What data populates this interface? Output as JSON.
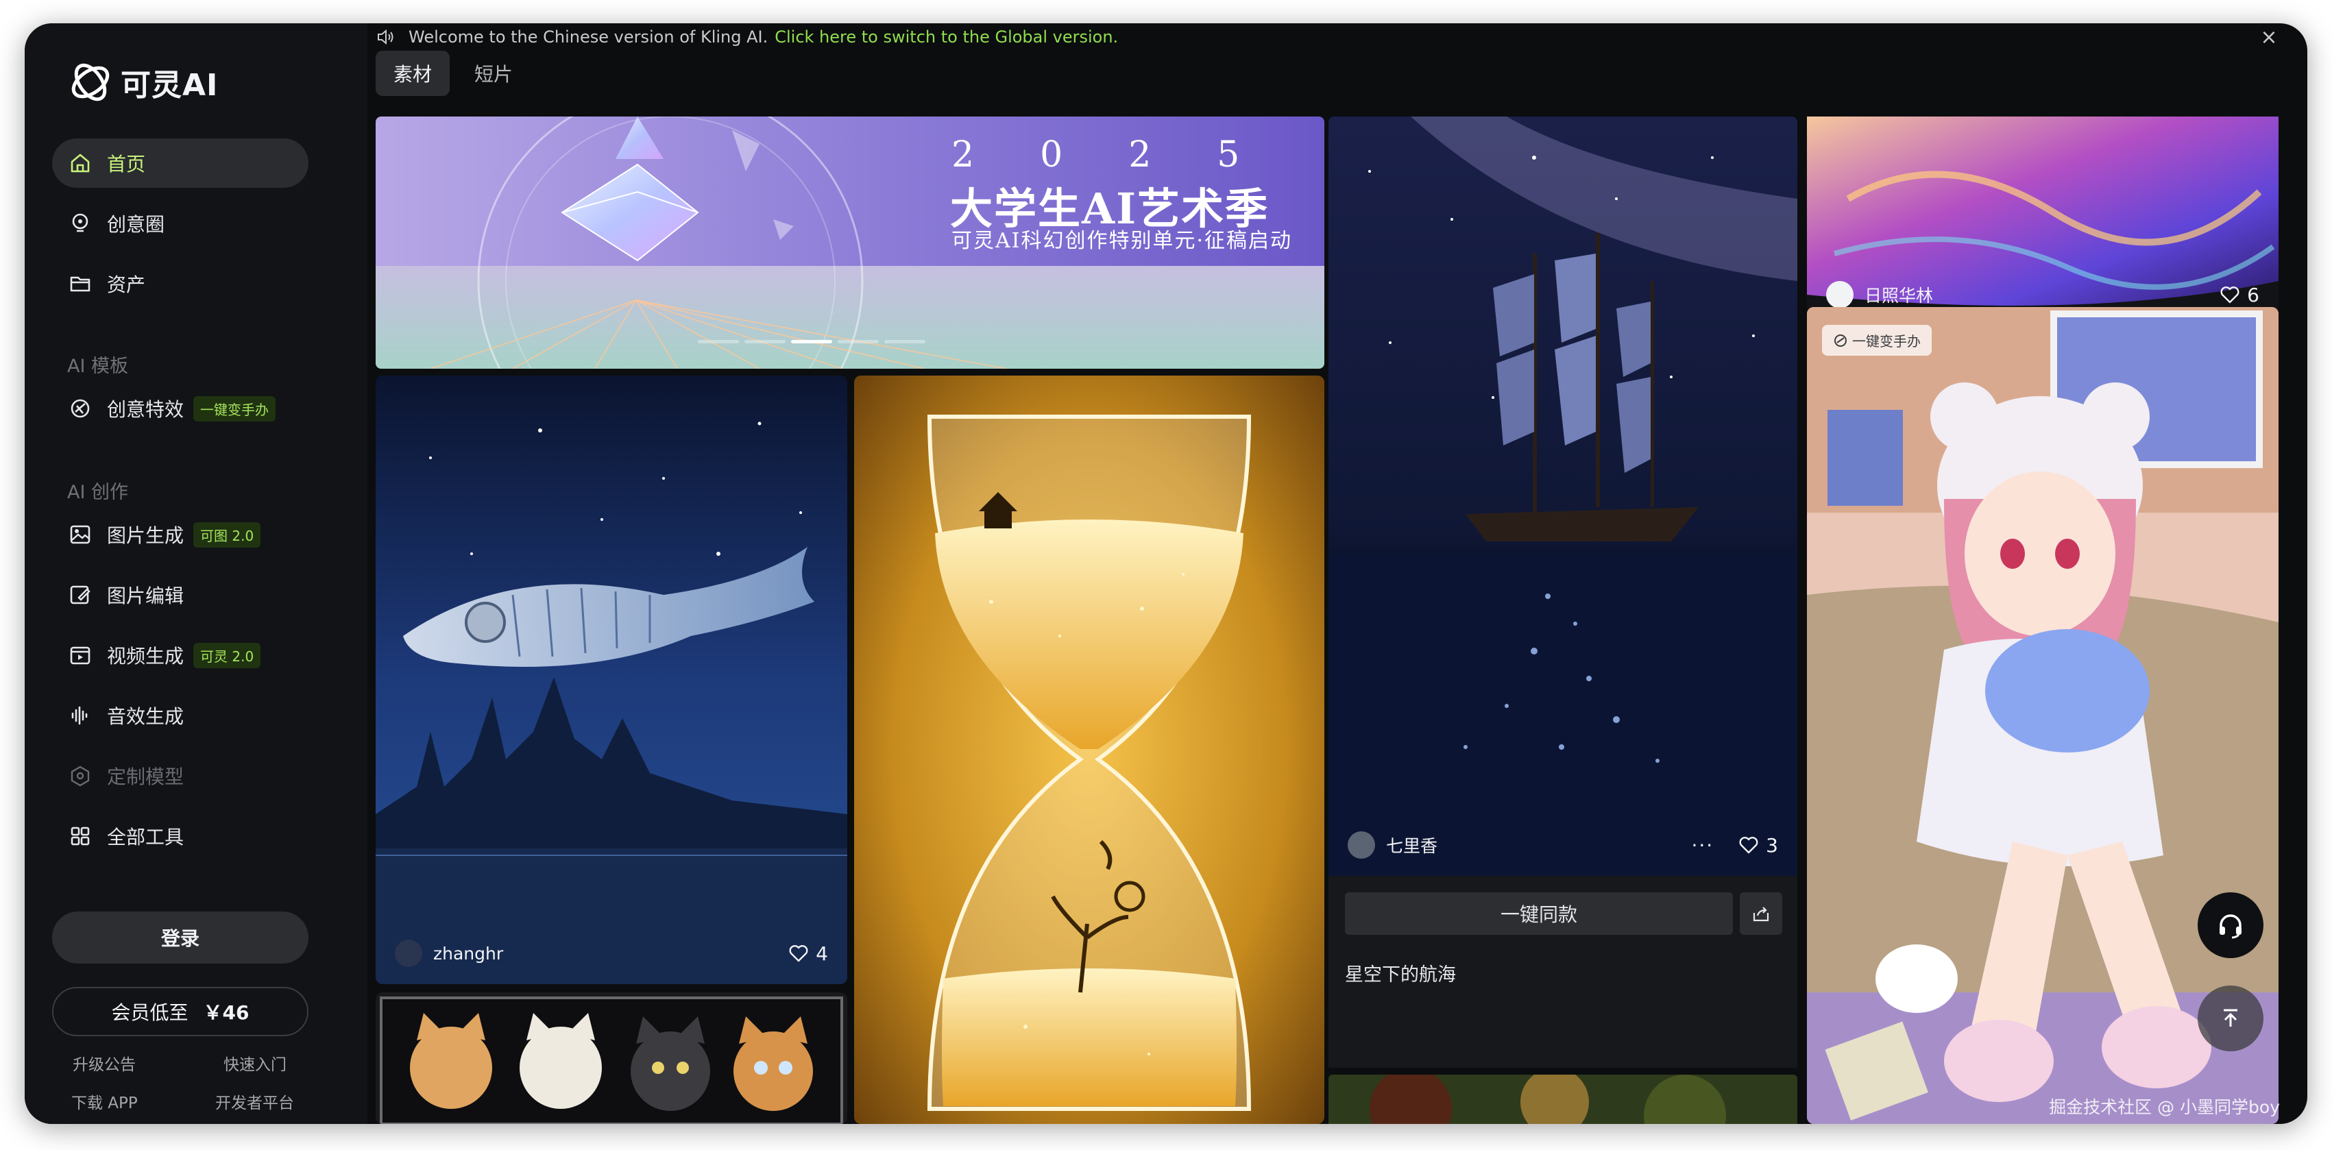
{
  "app": {
    "logo_text": "可灵AI"
  },
  "sidebar": {
    "items": [
      {
        "label": "首页",
        "icon": "home-icon",
        "active": true
      },
      {
        "label": "创意圈",
        "icon": "bulb-icon"
      },
      {
        "label": "资产",
        "icon": "folder-icon"
      }
    ],
    "section_templates": "AI 模板",
    "template_items": [
      {
        "label": "创意特效",
        "icon": "effects-icon",
        "badge": "一键变手办"
      }
    ],
    "section_create": "AI 创作",
    "create_items": [
      {
        "label": "图片生成",
        "icon": "image-icon",
        "badge": "可图 2.0"
      },
      {
        "label": "图片编辑",
        "icon": "image-edit-icon"
      },
      {
        "label": "视频生成",
        "icon": "video-icon",
        "badge": "可灵 2.0"
      },
      {
        "label": "音效生成",
        "icon": "audio-wave-icon"
      },
      {
        "label": "定制模型",
        "icon": "model-cube-icon",
        "disabled": true
      },
      {
        "label": "全部工具",
        "icon": "grid-icon"
      }
    ],
    "login_label": "登录",
    "member_label": "会员低至",
    "member_price": "￥46",
    "footer_links": [
      "升级公告",
      "快速入门",
      "下载 APP",
      "开发者平台"
    ]
  },
  "topbar": {
    "notice_text": "Welcome to the Chinese version of Kling AI.",
    "notice_link": "Click here to switch to the Global version.",
    "close_glyph": "×",
    "tabs": [
      {
        "label": "素材",
        "active": true
      },
      {
        "label": "短片",
        "active": false
      }
    ]
  },
  "banner": {
    "year_digits": [
      "2",
      "0",
      "2",
      "5"
    ],
    "title": "大学生AI艺术季",
    "subtitle": "可灵AI科幻创作特别单元·征稿启动"
  },
  "cards": {
    "whale": {
      "author": "zhanghr",
      "likes": "4"
    },
    "ship": {
      "author": "七里香",
      "likes": "3",
      "more": "···"
    },
    "ship_detail": {
      "same_label": "一键同款",
      "title": "星空下的航海"
    },
    "top_right": {
      "author": "日照华林",
      "likes": "6"
    },
    "anime": {
      "tag": "一键变手办"
    }
  },
  "watermark": "掘金技术社区 @ 小墨同学boy",
  "colors": {
    "accent": "#a6e35a",
    "background": "#0c0d0f",
    "sidebar": "#121316",
    "link": "#8fdd4e"
  }
}
